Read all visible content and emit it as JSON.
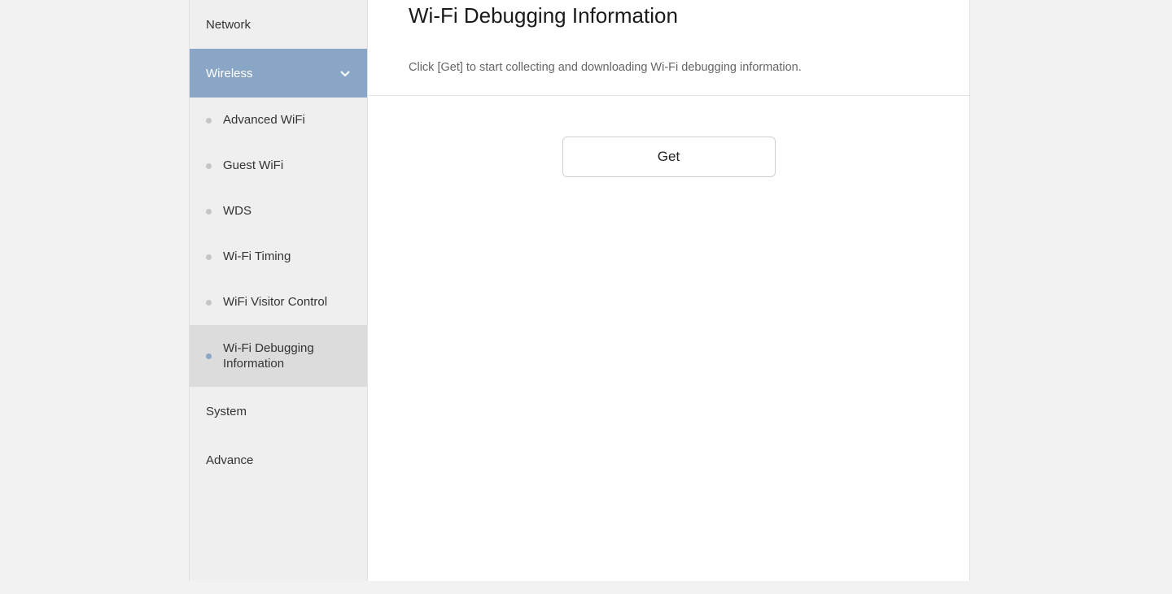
{
  "sidebar": {
    "items": [
      {
        "label": "Network"
      },
      {
        "label": "Wireless",
        "expanded": true,
        "subitems": [
          {
            "label": "Advanced WiFi"
          },
          {
            "label": "Guest WiFi"
          },
          {
            "label": "WDS"
          },
          {
            "label": "Wi-Fi Timing"
          },
          {
            "label": "WiFi Visitor Control"
          },
          {
            "label": "Wi-Fi Debugging Information",
            "active": true
          }
        ]
      },
      {
        "label": "System"
      },
      {
        "label": "Advance"
      }
    ]
  },
  "main": {
    "title": "Wi-Fi Debugging Information",
    "description": "Click [Get] to start collecting and downloading Wi-Fi debugging information.",
    "get_label": "Get"
  }
}
